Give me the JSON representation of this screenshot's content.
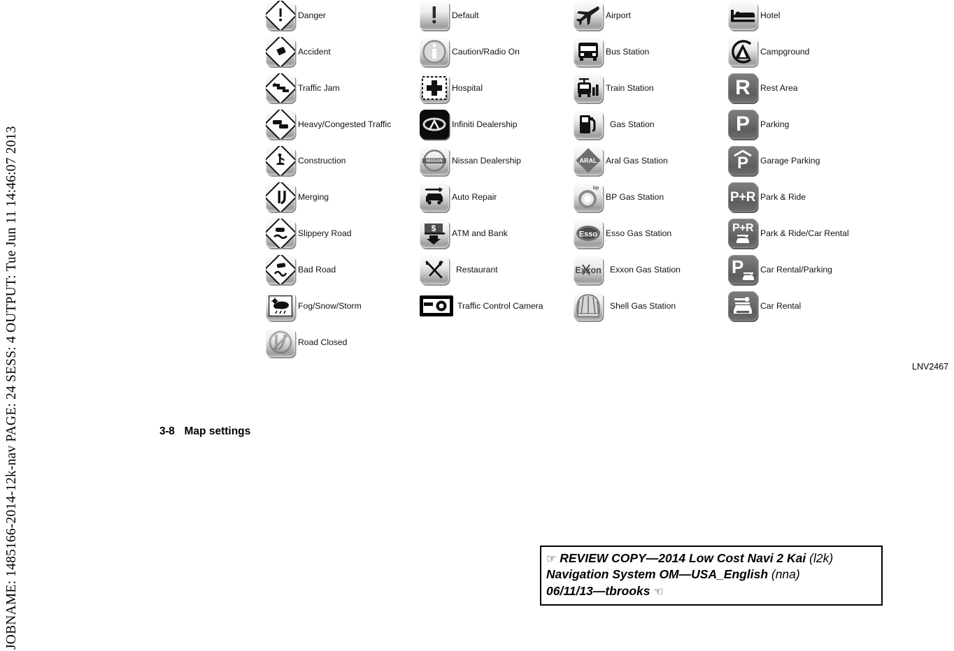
{
  "jobname_strip": "JOBNAME: 1485166-2014-12k-nav  PAGE: 24  SESS: 4  OUTPUT: Tue Jun 11 14:46:07 2013",
  "figure_id": "LNV2467",
  "footer": {
    "page_number": "3-8",
    "section_title": "Map settings"
  },
  "review_stamp": {
    "line1_a": "REVIEW COPY—2014 Low Cost Navi 2 Kai ",
    "line1_b": "(l2k)",
    "line2_a": "Navigation System OM—USA_English ",
    "line2_b": "(nna)",
    "line3": "06/11/13—tbrooks",
    "hand_left": "☞",
    "hand_right": "☜"
  },
  "legend": {
    "columns": [
      {
        "items": [
          {
            "label": "Danger",
            "icon": "danger-diamond-icon"
          },
          {
            "label": "Accident",
            "icon": "accident-diamond-icon"
          },
          {
            "label": "Traffic Jam",
            "icon": "traffic-jam-diamond-icon"
          },
          {
            "label": "Heavy/Congested Traffic",
            "icon": "heavy-congested-traffic-diamond-icon"
          },
          {
            "label": "Construction",
            "icon": "construction-diamond-icon"
          },
          {
            "label": "Merging",
            "icon": "merging-diamond-icon"
          },
          {
            "label": "Slippery Road",
            "icon": "slippery-road-diamond-icon"
          },
          {
            "label": "Bad Road",
            "icon": "bad-road-diamond-icon"
          },
          {
            "label": "Fog/Snow/Storm",
            "icon": "fog-snow-storm-icon"
          },
          {
            "label": "Road Closed",
            "icon": "road-closed-icon"
          }
        ]
      },
      {
        "items": [
          {
            "label": "Default",
            "icon": "default-exclamation-icon"
          },
          {
            "label": "Caution/Radio On",
            "icon": "caution-radio-on-icon"
          },
          {
            "label": "Hospital",
            "icon": "hospital-icon"
          },
          {
            "label": "Infiniti Dealership",
            "icon": "infiniti-dealership-icon"
          },
          {
            "label": "Nissan Dealership",
            "icon": "nissan-dealership-icon"
          },
          {
            "label": "Auto Repair",
            "icon": "auto-repair-icon"
          },
          {
            "label": "ATM and Bank",
            "icon": "atm-and-bank-icon"
          },
          {
            "label": "Restaurant",
            "icon": "restaurant-icon"
          },
          {
            "label": "Traffic Control Camera",
            "icon": "traffic-control-camera-icon"
          }
        ]
      },
      {
        "items": [
          {
            "label": "Airport",
            "icon": "airport-icon"
          },
          {
            "label": "Bus Station",
            "icon": "bus-station-icon"
          },
          {
            "label": "Train Station",
            "icon": "train-station-icon"
          },
          {
            "label": "Gas Station",
            "icon": "gas-station-icon"
          },
          {
            "label": "Aral Gas Station",
            "icon": "aral-gas-station-icon"
          },
          {
            "label": "BP Gas Station",
            "icon": "bp-gas-station-icon"
          },
          {
            "label": "Esso Gas Station",
            "icon": "esso-gas-station-icon"
          },
          {
            "label": "Exxon Gas Station",
            "icon": "exxon-gas-station-icon"
          },
          {
            "label": "Shell Gas Station",
            "icon": "shell-gas-station-icon"
          }
        ]
      },
      {
        "items": [
          {
            "label": "Hotel",
            "icon": "hotel-icon"
          },
          {
            "label": "Campground",
            "icon": "campground-icon"
          },
          {
            "label": "Rest Area",
            "icon": "rest-area-icon"
          },
          {
            "label": "Parking",
            "icon": "parking-icon"
          },
          {
            "label": "Garage Parking",
            "icon": "garage-parking-icon"
          },
          {
            "label": "Park & Ride",
            "icon": "park-and-ride-icon"
          },
          {
            "label": "Park & Ride/Car Rental",
            "icon": "park-and-ride-car-rental-icon"
          },
          {
            "label": "Car Rental/Parking",
            "icon": "car-rental-parking-icon"
          },
          {
            "label": "Car Rental",
            "icon": "car-rental-icon"
          }
        ]
      }
    ],
    "badge_text": {
      "aral": "ARAL",
      "esso": "Esso",
      "exxon": "Exxon",
      "rest_area": "R",
      "parking": "P",
      "garage_parking": "P",
      "park_ride": "P+R",
      "park_ride_car_rental": "P+R",
      "car_rental_parking": "P"
    }
  }
}
